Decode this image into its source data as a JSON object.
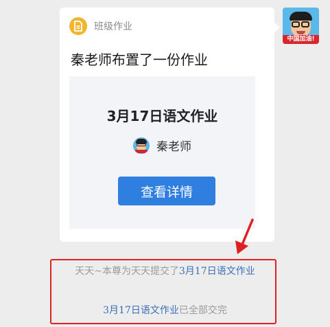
{
  "message": {
    "header_label": "班级作业",
    "title": "秦老师布置了一份作业",
    "homework_name": "3月17日语文作业",
    "teacher_name": "秦老师",
    "button_label": "查看详情"
  },
  "sender_avatar": {
    "banner_text": "中国加油!"
  },
  "system_notices": {
    "line1_prefix": "天天~本尊为天天提交了",
    "line1_link": "3月17日语文作业",
    "line2_link": "3月17日语文作业",
    "line2_suffix": "已全部交完"
  },
  "colors": {
    "accent_blue": "#2f7fe0",
    "link_blue": "#3a6fb7",
    "highlight_red": "#e02020",
    "icon_yellow": "#f2b52e"
  },
  "icons": {
    "header": "homework-doc-icon",
    "annotation": "red-arrow-icon"
  }
}
